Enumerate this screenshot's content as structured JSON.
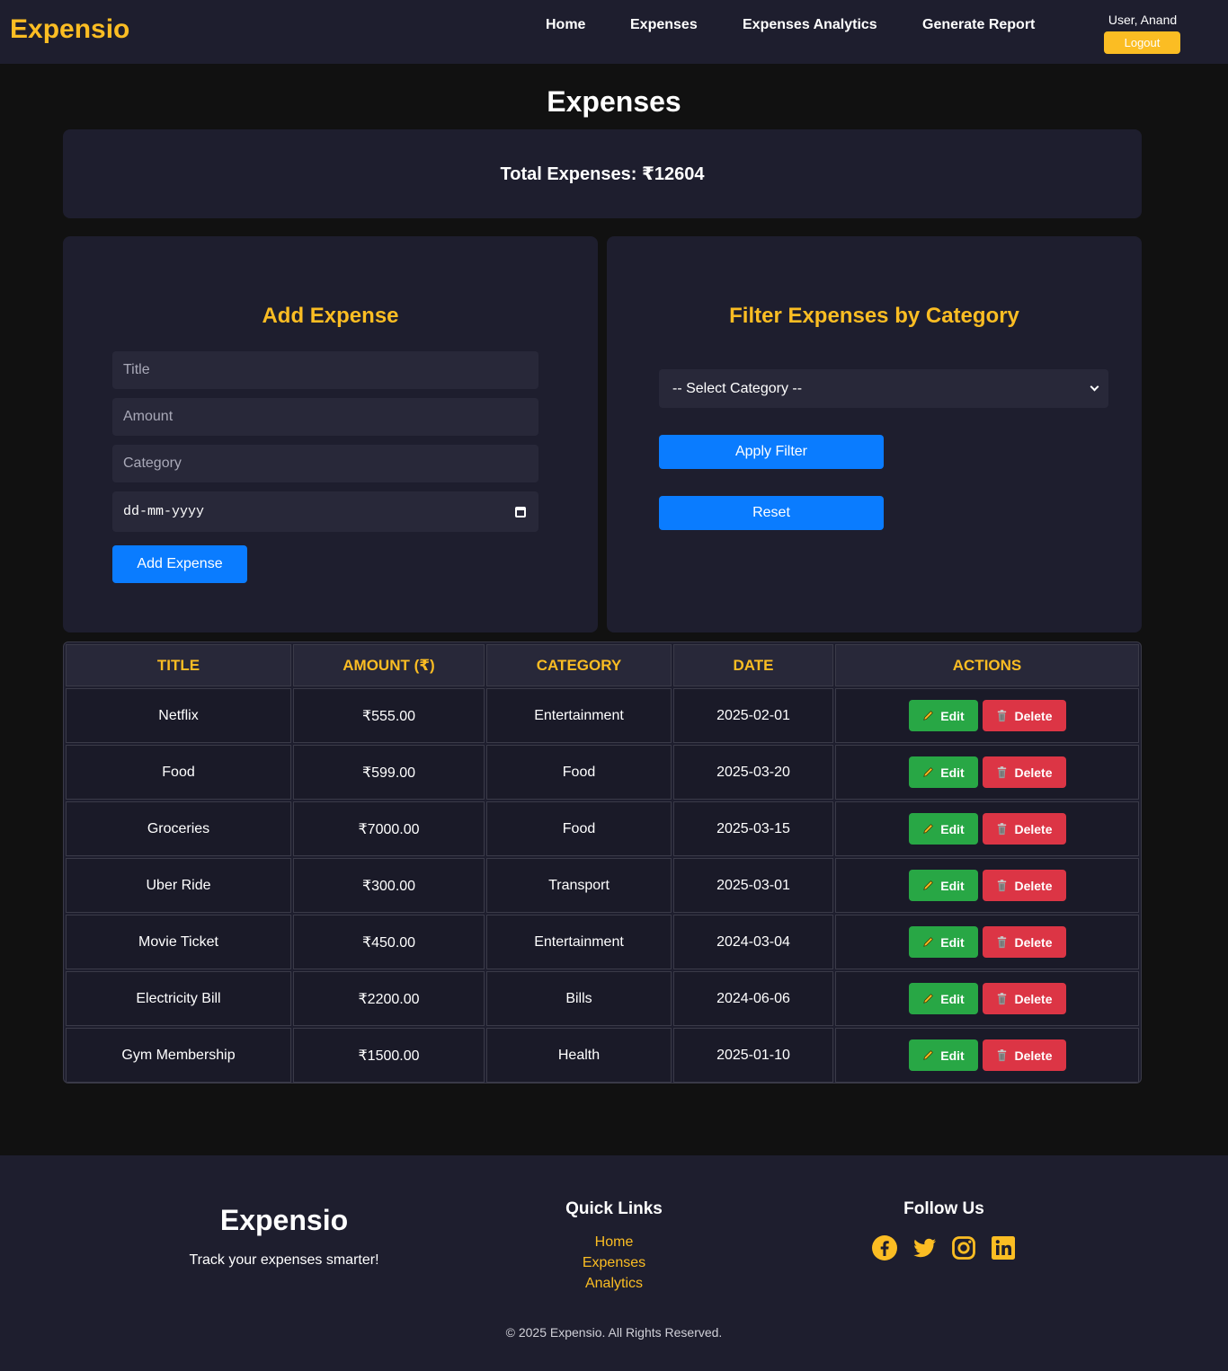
{
  "navbar": {
    "brand": "Expensio",
    "links": [
      "Home",
      "Expenses",
      "Expenses Analytics",
      "Generate Report"
    ],
    "user_label": "User, Anand",
    "logout_label": "Logout"
  },
  "page": {
    "title": "Expenses",
    "total_label": "Total Expenses: ₹12604"
  },
  "add_form": {
    "heading": "Add Expense",
    "title_placeholder": "Title",
    "amount_placeholder": "Amount",
    "category_placeholder": "Category",
    "date_placeholder": "dd-mm-yyyy",
    "submit_label": "Add Expense"
  },
  "filter": {
    "heading": "Filter Expenses by Category",
    "select_value": "-- Select Category --",
    "apply_label": "Apply Filter",
    "reset_label": "Reset"
  },
  "table": {
    "headers": [
      "Title",
      "Amount (₹)",
      "Category",
      "Date",
      "Actions"
    ],
    "edit_label": "Edit",
    "delete_label": "Delete",
    "rows": [
      {
        "title": "Netflix",
        "amount": "₹555.00",
        "category": "Entertainment",
        "date": "2025-02-01"
      },
      {
        "title": "Food",
        "amount": "₹599.00",
        "category": "Food",
        "date": "2025-03-20"
      },
      {
        "title": "Groceries",
        "amount": "₹7000.00",
        "category": "Food",
        "date": "2025-03-15"
      },
      {
        "title": "Uber Ride",
        "amount": "₹300.00",
        "category": "Transport",
        "date": "2025-03-01"
      },
      {
        "title": "Movie Ticket",
        "amount": "₹450.00",
        "category": "Entertainment",
        "date": "2024-03-04"
      },
      {
        "title": "Electricity Bill",
        "amount": "₹2200.00",
        "category": "Bills",
        "date": "2024-06-06"
      },
      {
        "title": "Gym Membership",
        "amount": "₹1500.00",
        "category": "Health",
        "date": "2025-01-10"
      }
    ]
  },
  "footer": {
    "brand": "Expensio",
    "tagline": "Track your expenses smarter!",
    "quick_links_heading": "Quick Links",
    "quick_links": [
      "Home",
      "Expenses",
      "Analytics"
    ],
    "follow_heading": "Follow Us",
    "socials": [
      "facebook-icon",
      "twitter-icon",
      "instagram-icon",
      "linkedin-icon"
    ],
    "copyright": "© 2025 Expensio. All Rights Reserved."
  },
  "colors": {
    "accent": "#fbbd23",
    "primary_button": "#0a7cff",
    "edit_button": "#28a745",
    "delete_button": "#dc3545",
    "panel": "#1e1e2e",
    "background": "#111111"
  }
}
